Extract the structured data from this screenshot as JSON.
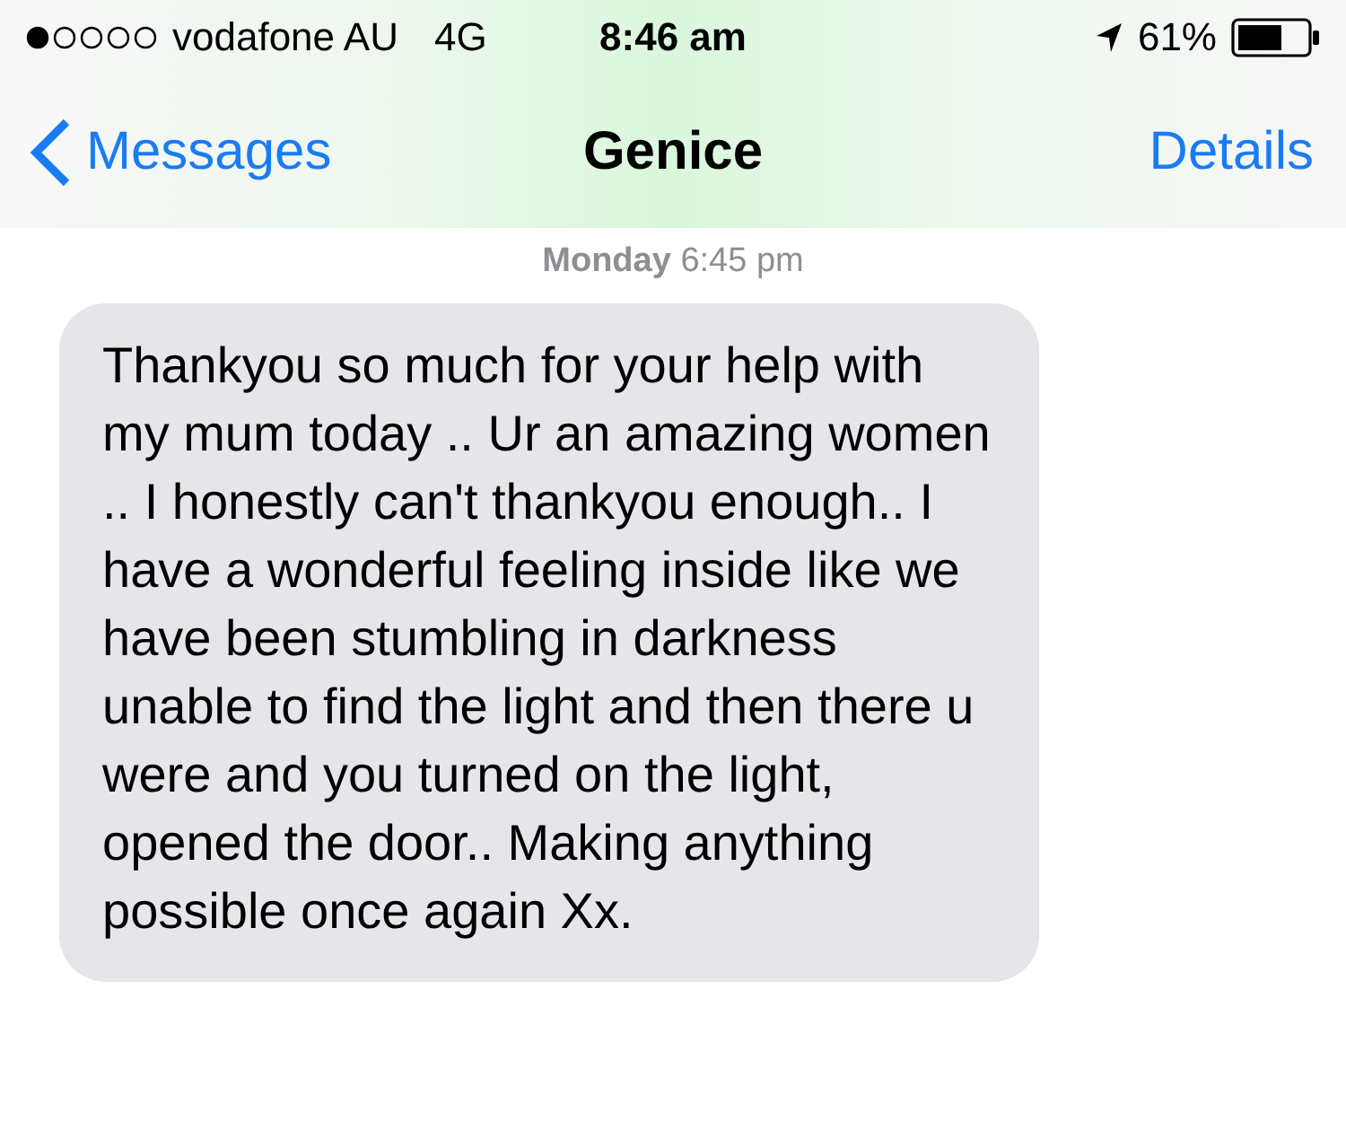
{
  "status_bar": {
    "carrier": "vodafone AU",
    "network": "4G",
    "time": "8:46 am",
    "battery": "61%"
  },
  "nav": {
    "back": "Messages",
    "title": "Genice",
    "action": "Details"
  },
  "timestamp": "**Monday** 6:45 pm",
  "messages": [
    {
      "kind": "incoming",
      "text": "Thankyou so much for your help with my mum today .. Ur an amazing women .. I honestly can't thankyou enough.. I have a wonderful feeling inside like we have been stumbling in darkness unable to find the light and then there u were and you turned on the light, opened the door.. Making anything possible once again Xx."
    }
  ]
}
